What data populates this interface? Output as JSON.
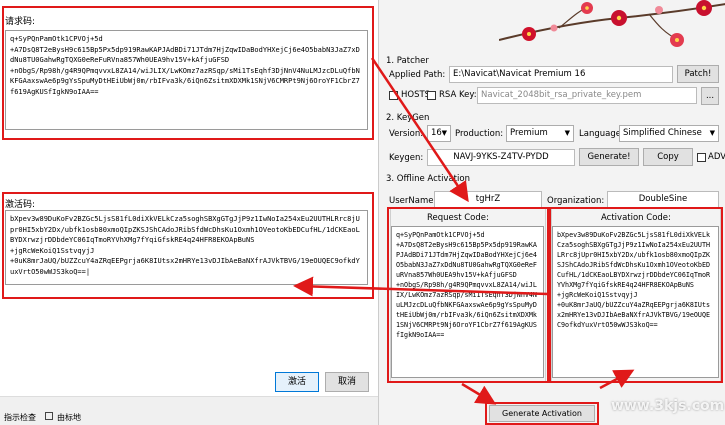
{
  "dialog": {
    "request_label": "请求码:",
    "request_code": "q+SyPQnPamOtk1CPVOj+5d\n+A7DsQ8T2eBysH9c615Bp5Px5dp919RawKAPJAdBDi71JTdm7HjZqwIDaBodYHXejCj6e4O5babN3JaZ7xDdNu8TU0GahwRgTQXG0eReFuRVna857Wh0UEA9hv15V+kAfjuGFSD\n+nObgS/Rp98h/g4R9QPmqvvxL8ZA14/wiJLIX/LwKOmz7azRSqp/sMi1TsEqhf3DjNnV4NuLMJzcDLuQfbNKFGAaxswAe6p9gYsSpuMyDtHEiUbWj0m/rbIFva3k/6iQn6ZsitmXDXMk1SNjV6CMRPt9Nj6OroYF1CbrZ7f619AgKUSfIgkN9oIAA==",
    "activation_label": "激活码:",
    "activation_code": "bXpev3w89DuKoFv2BZGc5LjsS81fL0diXkVELkCza5soghSBXgGTgJjP9z1IwNoIa254xEu2UUTHLRrc8jUpr0HI5xbY2Dx/ubfk1osb80xmoQIpZKSJShCAdoJRibSfdWcDhsKu1Oxmh1OVeotoKbEDCufHL/1dCKEaoLBYDXrwzjrDDbdeYC06IqTmoRYVhXMg7fYqiGfskRE4q24HFR8EKOApBuNS\n+jgRcWeKoiQ1SstvqyjJ\n+0uK8mrJaUQ/bUZZcuY4aZRqEEPgrja6K8IUtsx2mHRYe13vDJIbAeBaNXfrAJVkTBVG/19eOUQEC9ofkdYuxVrtO50wWJS3koQ==|",
    "activate_btn": "激活",
    "cancel_btn": "取消",
    "status_left": "指示检查",
    "status_right": "由标地"
  },
  "keygen": {
    "patcher_title": "1. Patcher",
    "applied_path_label": "Applied Path:",
    "applied_path": "E:\\Navicat\\Navicat Premium 16",
    "patch_btn": "Patch!",
    "hosts_label": "HOSTS",
    "rsa_label": "RSA Key:",
    "rsa_placeholder": "Navicat_2048bit_rsa_private_key.pem",
    "browse_btn": "...",
    "keygen_title": "2. KeyGen",
    "version_label": "Version:",
    "version": "16",
    "production_label": "Production:",
    "production": "Premium",
    "language_label": "Language:",
    "language": "Simplified Chinese",
    "keygen_label": "Keygen:",
    "key": "NAVJ-9YKS-Z4TV-PYDD",
    "generate_btn": "Generate!",
    "copy_btn": "Copy",
    "adv_label": "ADV",
    "offline_title": "3. Offline Activation",
    "username_label": "UserName:",
    "username": "tgHrZ",
    "organization_label": "Organization:",
    "organization": "DoubleSine",
    "request_title": "Request Code:",
    "request_code": "q+SyPQnPamOtk1CPVOj+5d\n+A7DsQ8T2eBysH9c615Bp5Px5dp919RawKAPJAdBDi71JTdm7HjZqwIDaBodYHXejCj6e4O5babN3JaZ7xDdNu8TU0GahwRgTQXG0eReFuRVna857Wh0UEA9hv15V+kAfjuGFSD\n+nObgS/Rp98h/g4R9QPmqvvxL8ZA14/wiJLIX/LwKOmz7azRSqp/sMi1TsEqhf3DjNnV4NuLMJzcDLuQfbNKFGAaxswAe6p9gYsSpuMyDtHEiUbWj0m/rbIFva3k/6iQn6ZsitmXDXMk1SNjV6CMRPt9Nj6OroYF1CbrZ7f619AgKUSfIgkN9oIAA==",
    "activation_title": "Activation Code:",
    "activation_code": "bXpev3w89DuKoFv2BZGc5LjsS81fL0diXkVELkCza5soghSBXgGTgJjP9z1IwNoIa254xEu2UUTHLRrc8jUpr0HI5xbY2Dx/ubfk1osb80xmoQIpZKSJShCAdoJRibSfdWcDhsKu1Oxmh1OVeotoKbEDCufHL/1dCKEaoLBYDXrwzjrDDbdeYC06IqTmoRYVhXMg7fYqiGfskRE4q24HFR8EKOApBuNS\n+jgRcWeKoiQ1SstvqyjJ\n+0uK8mrJaUQ/bUZZcuY4aZRqEEPgrja6K8IUtsx2mHRYe13vDJIbAeBaNXfrAJVkTBVG/19eOUQEC9ofkdYuxVrtO50wWJS3koQ==",
    "gen_activation_btn": "Generate Activation Code!",
    "watermark": "www.3kjs.com"
  },
  "colors": {
    "highlight": "#e01919",
    "blossom": "#c8102e",
    "window_bg": "#f3f3f3"
  }
}
